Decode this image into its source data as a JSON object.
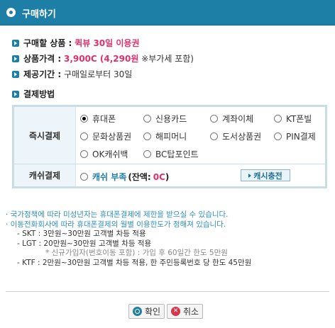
{
  "header": {
    "title": "구매하기"
  },
  "product": {
    "name_label": "구매할 상품 :",
    "name_value": "퀵뷰 30일 이용권",
    "price_label": "상품가격 :",
    "price_value": "3,900C (4,290원",
    "price_note": "※부가세 포함)",
    "period_label": "제공기간 :",
    "period_value": "구매일로부터 30일"
  },
  "payment": {
    "section_title": "결제방법",
    "instant_label": "즉시결제",
    "options": [
      "휴대폰",
      "신용카드",
      "계좌이체",
      "KT폰빌",
      "문화상품권",
      "해피머니",
      "도서상품권",
      "PIN결제",
      "OK캐쉬백",
      "BC탑포인트"
    ],
    "selected": "휴대폰",
    "cash_label": "캐쉬결제",
    "cash_option": "캐쉬 부족",
    "cash_balance_label": "(잔액:",
    "cash_balance_value": "0C",
    "cash_balance_close": ")",
    "charge_button": "캐시충전"
  },
  "notes": {
    "line1": "· 국가정책에 따라 미성년자는 휴대폰결제에 제한을 받으실 수 있습니다.",
    "line2": "· 이동전화회사에 따라 휴대폰결제의 월별 이용한도가 정해져 있습니다.",
    "skt": "- SKT : 3만원~30만원 고객별 차등 적용",
    "lgt": "- LGT : 20만원~30만원 고객별 차등 적용",
    "lgt_sub": "* 신규가입자(번호이동 포함) : 가입 후 60일간 한도 5만원",
    "ktf": "- KTF : 2만원~30만원 고객별 차등 적용, 한 주민등록번호 당 한도 45만원"
  },
  "buttons": {
    "ok": "확인",
    "cancel": "취소"
  }
}
